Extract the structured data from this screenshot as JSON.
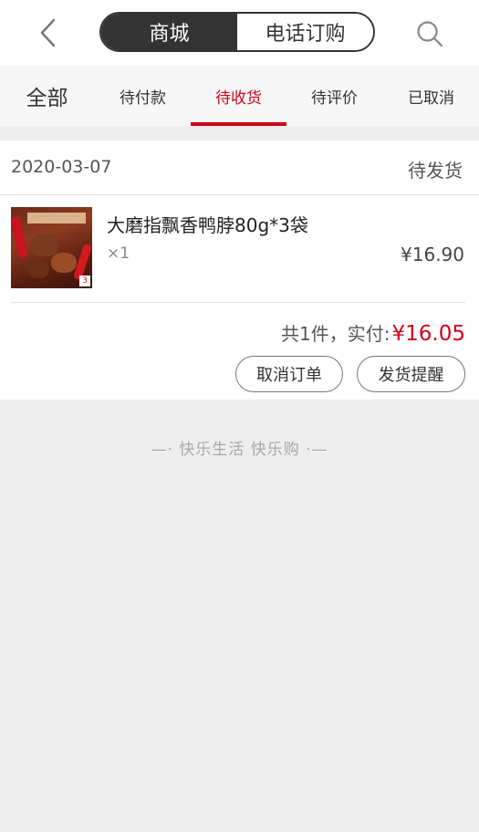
{
  "header": {
    "segment_tabs": [
      {
        "label": "商城",
        "active": true
      },
      {
        "label": "电话订购",
        "active": false
      }
    ],
    "back_icon": "chevron-left-icon",
    "search_icon": "search-icon"
  },
  "order_tabs": [
    {
      "label": "全部",
      "active": false
    },
    {
      "label": "待付款",
      "active": false
    },
    {
      "label": "待收货",
      "active": true
    },
    {
      "label": "待评价",
      "active": false
    },
    {
      "label": "已取消",
      "active": false
    }
  ],
  "order": {
    "date": "2020-03-07",
    "status": "待发货",
    "product": {
      "name": "大磨指飘香鸭脖80g*3袋",
      "quantity": "×1",
      "price": "¥16.90"
    },
    "summary_label": "共1件，实付:",
    "summary_amount": "¥16.05",
    "buttons": {
      "cancel": "取消订单",
      "remind": "发货提醒"
    }
  },
  "footer": {
    "slogan": "—· 快乐生活 快乐购 ·—"
  },
  "colors": {
    "accent": "#d0021b",
    "segment_active_bg": "#333333",
    "page_bg": "#eeeeee"
  }
}
